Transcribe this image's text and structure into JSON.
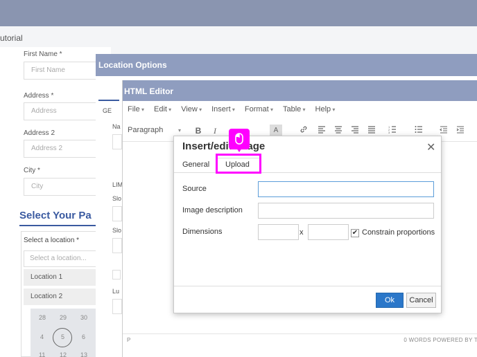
{
  "background": {
    "tutorial_label": "utorial",
    "fields": [
      {
        "label": "First Name *",
        "placeholder": "First Name"
      },
      {
        "label": "Address *",
        "placeholder": "Address"
      },
      {
        "label": "Address 2",
        "placeholder": "Address 2"
      },
      {
        "label": "City *",
        "placeholder": "City"
      }
    ],
    "section_heading": "Select Your Pa",
    "select_label": "Select a location *",
    "select_placeholder": "Select a location...",
    "locations": [
      "Location 1",
      "Location 2"
    ],
    "calendar": [
      "28",
      "29",
      "30",
      "4",
      "5",
      "6",
      "11",
      "12",
      "13"
    ]
  },
  "location_modal": {
    "title": "Location Options",
    "side_labels": [
      "GE",
      "Na",
      "LIM",
      "Slo",
      "Slo",
      "Lu"
    ]
  },
  "editor": {
    "title": "HTML Editor",
    "menu": [
      "File",
      "Edit",
      "View",
      "Insert",
      "Format",
      "Table",
      "Help"
    ],
    "block_format": "Paragraph",
    "status_path": "P",
    "status_words": "0 WORDS POWERED BY T"
  },
  "dialog": {
    "title": "Insert/edit image",
    "tabs": {
      "general": "General",
      "upload": "Upload"
    },
    "source_label": "Source",
    "source_value": "",
    "description_label": "Image description",
    "description_value": "",
    "dimensions_label": "Dimensions",
    "width_value": "",
    "height_value": "",
    "dimension_separator": "x",
    "constrain_label": "Constrain proportions",
    "constrain_checked": true,
    "ok_label": "Ok",
    "cancel_label": "Cancel",
    "close_glyph": "✕"
  },
  "highlight": {
    "color": "#ff00ff",
    "icon": "mouse-icon"
  },
  "colors": {
    "header_bg": "#8f9dbf",
    "primary_button": "#2b77c9",
    "focus_border": "#5b9dd9"
  }
}
